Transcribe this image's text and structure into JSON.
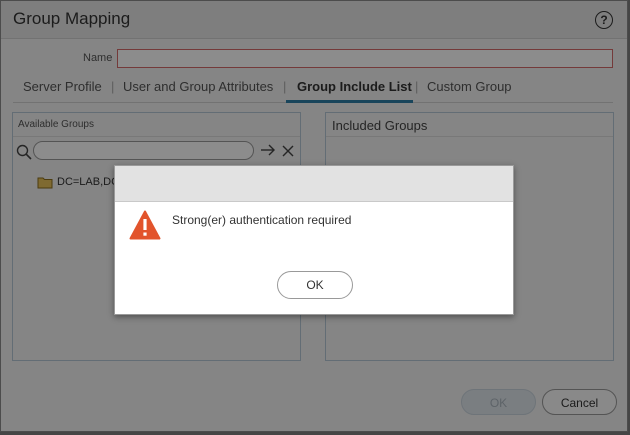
{
  "dialog": {
    "title": "Group Mapping",
    "help_icon": "help-circle-icon",
    "name_label": "Name",
    "name_value": "",
    "tabs": [
      {
        "label": "Server Profile",
        "active": false
      },
      {
        "label": "User and Group Attributes",
        "active": false
      },
      {
        "label": "Group Include List",
        "active": true
      },
      {
        "label": "Custom Group",
        "active": false
      }
    ],
    "available_groups": {
      "header": "Available Groups",
      "search_value": "",
      "items": [
        "DC=LAB,DC"
      ]
    },
    "included_groups": {
      "header": "Included Groups"
    },
    "buttons": {
      "ok": "OK",
      "cancel": "Cancel"
    }
  },
  "alert": {
    "icon": "warning-triangle-icon",
    "message": "Strong(er) authentication required",
    "ok": "OK"
  },
  "colors": {
    "accent": "#2e7ea6",
    "warning": "#e2542c"
  }
}
